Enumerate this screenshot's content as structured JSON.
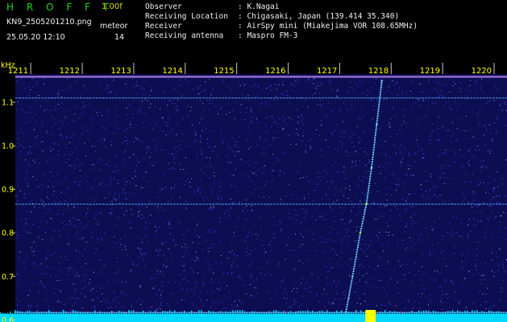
{
  "header": {
    "app_title": "H R O F F T",
    "app_version": "1.00f",
    "file_name": "KN9_2505201210.png",
    "meteor_label": "meteor",
    "timestamp": "25.05.20 12:10",
    "meteor_count": "14",
    "info": [
      {
        "label": "Observer",
        "value": ": K.Nagai"
      },
      {
        "label": "Receiving Location",
        "value": ": Chigasaki, Japan (139.414 35.340)"
      },
      {
        "label": "Receiver",
        "value": ": AirSpy mini (Miakejima VOR 108.65MHz)"
      },
      {
        "label": "Receiving antenna",
        "value": ": Maspro FM-3"
      }
    ]
  },
  "colors": {
    "background": "#000000",
    "plot_background": "#0d0d52",
    "noise_blue": "#3a3ad8",
    "noise_white": "#d8d8ff",
    "tick_label": "#ffff00",
    "title_green": "#27d21f",
    "version_yellow": "#d6d600",
    "carrier_line": "#4fb6ff",
    "meteor_trail": "#6fe0ff",
    "meteor_head": "#a8ff4a",
    "bottom_band": "#00d8ff",
    "bottom_burst": "#ffff00",
    "top_band": "#ff7ad8"
  },
  "chart_data": {
    "type": "heatmap",
    "title": "",
    "xlabel": "",
    "ylabel": "kHz",
    "x_ticks": [
      "1211",
      "1212",
      "1213",
      "1214",
      "1215",
      "1216",
      "1217",
      "1218",
      "1219",
      "1220"
    ],
    "xlim": [
      1210.7,
      1220.25
    ],
    "y_ticks": [
      "1.1",
      "1.0",
      "0.9",
      "0.8",
      "0.7",
      "0.6"
    ],
    "ylim": [
      0.595,
      1.165
    ],
    "grid": false,
    "horizontal_lines_khz": [
      {
        "name": "interference_1",
        "y": 1.159
      },
      {
        "name": "interference_2",
        "y": 1.11
      },
      {
        "name": "interference_3",
        "y": 0.866
      },
      {
        "name": "interference_4",
        "y": 0.617
      },
      {
        "name": "interference_5",
        "y": 0.605
      }
    ],
    "meteor_echo": {
      "x": [
        1217.12,
        1217.25,
        1217.4,
        1217.52,
        1217.62,
        1217.72,
        1217.82
      ],
      "y": [
        0.617,
        0.7,
        0.8,
        0.866,
        0.95,
        1.05,
        1.15
      ]
    },
    "bottom_burst_x": [
      1217.5,
      1217.7
    ]
  }
}
